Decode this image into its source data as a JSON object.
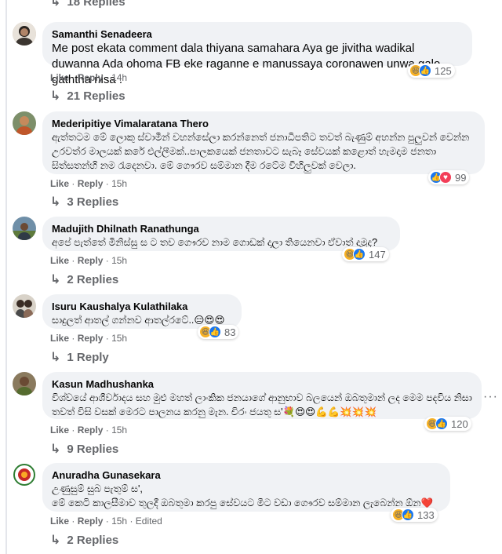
{
  "comments": [
    {
      "author": "Samanthi Senadeera",
      "text": "Me post ekata comment dala thiyana samahara Aya ge jivitha wadikal duwanna Ada ohoma FB eke raganne e manussaya coronawen unwa galo gaththa nisa .",
      "like": "Like",
      "reply": "Reply",
      "time": "14h",
      "edited": "",
      "reaction_count": "125",
      "reactions": [
        "haha-icon",
        "like-icon"
      ],
      "replies": "21 Replies"
    },
    {
      "author": "Mederipitiye Vimalaratana Thero",
      "text": "ඇත්තටම මේ ලොකු ස්වාමීන් වහන්සේලා කරන්නෙත් ජනාධිපතිට තවත් බැණුම් අහන්න පුලුවන් වෙන්න උරවත්ර මාලයක් කරේ එල්ලීමක්..පාලකයෙක් ජනතාවට සැබෑ සේවයක් කළොත් හැමදාම ජනතා සිත්සතන්හි නම රැදෙනවා. මේ ගෞරව සම්මාන දීම රටේම විහිලුවක් වෙලා.",
      "like": "Like",
      "reply": "Reply",
      "time": "15h",
      "edited": "",
      "reaction_count": "99",
      "reactions": [
        "like-icon",
        "love-icon"
      ],
      "replies": "3 Replies"
    },
    {
      "author": "Madujith Dhilnath Ranathunga",
      "text": "අපේ පැත්තේ මිනිස්සු ස ට තව ගෞරව නාම ගොඩක් දාලා තියෙනවා ඒවාත් දාමුද?",
      "like": "Like",
      "reply": "Reply",
      "time": "15h",
      "edited": "",
      "reaction_count": "147",
      "reactions": [
        "haha-icon",
        "like-icon"
      ],
      "replies": "2 Replies"
    },
    {
      "author": "Isuru Kaushalya Kulathilaka",
      "text": "සාදුලත් ආතල් ගන්නව ආතල්රටේ..😑😍😍",
      "like": "Like",
      "reply": "Reply",
      "time": "15h",
      "edited": "",
      "reaction_count": "83",
      "reactions": [
        "haha-icon",
        "like-icon"
      ],
      "replies": "1 Reply"
    },
    {
      "author": "Kasun Madhushanka",
      "text": "විශ්වයේ ආශීර්වාදය සහ මුළු මහත් ලාංකික ජනයාගේ ආනුභාව බලයෙන් ඔබතුමාන් ලද මෙම පදවිය නිසා තවත් විසි වසක් මෙරට පාලනය කරනු මැන. චිරං ජයතු ස'💐😍😍💪💪💥💥💥",
      "like": "Like",
      "reply": "Reply",
      "time": "15h",
      "edited": "",
      "reaction_count": "120",
      "reactions": [
        "haha-icon",
        "like-icon"
      ],
      "replies": "9 Replies"
    },
    {
      "author": "Anuradha Gunasekara",
      "text": "උණුසුම් සුබ පැතුම් ස',\nමේ කෙටි කාලසීමාව තුලදී ඔබතුමා කරපු සේවයට මීට වඩා ගෞරව සම්මාන ලැබෙන්න ඕන❤️",
      "like": "Like",
      "reply": "Reply",
      "time": "15h",
      "edited": "Edited",
      "reaction_count": "133",
      "reactions": [
        "haha-icon",
        "like-icon"
      ],
      "replies": "2 Replies"
    }
  ],
  "top_replies": "18 Replies",
  "more_menu": "···",
  "separator": "·",
  "colors": {
    "bubble": "#f0f2f5",
    "secondary_text": "#65676b",
    "like_blue": "#1877f2",
    "haha_yellow": "#f7b125",
    "love_red": "#f33e58"
  }
}
